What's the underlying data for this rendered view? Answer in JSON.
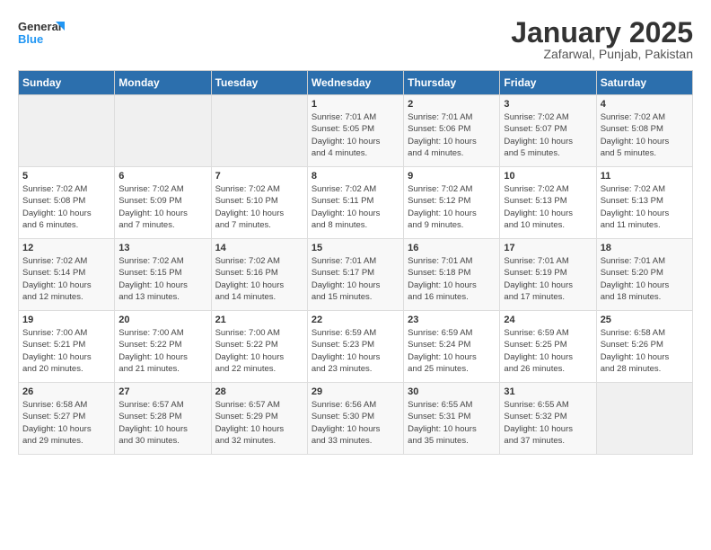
{
  "logo": {
    "line1": "General",
    "line2": "Blue"
  },
  "title": "January 2025",
  "subtitle": "Zafarwal, Punjab, Pakistan",
  "weekdays": [
    "Sunday",
    "Monday",
    "Tuesday",
    "Wednesday",
    "Thursday",
    "Friday",
    "Saturday"
  ],
  "weeks": [
    [
      {
        "day": "",
        "info": ""
      },
      {
        "day": "",
        "info": ""
      },
      {
        "day": "",
        "info": ""
      },
      {
        "day": "1",
        "info": "Sunrise: 7:01 AM\nSunset: 5:05 PM\nDaylight: 10 hours\nand 4 minutes."
      },
      {
        "day": "2",
        "info": "Sunrise: 7:01 AM\nSunset: 5:06 PM\nDaylight: 10 hours\nand 4 minutes."
      },
      {
        "day": "3",
        "info": "Sunrise: 7:02 AM\nSunset: 5:07 PM\nDaylight: 10 hours\nand 5 minutes."
      },
      {
        "day": "4",
        "info": "Sunrise: 7:02 AM\nSunset: 5:08 PM\nDaylight: 10 hours\nand 5 minutes."
      }
    ],
    [
      {
        "day": "5",
        "info": "Sunrise: 7:02 AM\nSunset: 5:08 PM\nDaylight: 10 hours\nand 6 minutes."
      },
      {
        "day": "6",
        "info": "Sunrise: 7:02 AM\nSunset: 5:09 PM\nDaylight: 10 hours\nand 7 minutes."
      },
      {
        "day": "7",
        "info": "Sunrise: 7:02 AM\nSunset: 5:10 PM\nDaylight: 10 hours\nand 7 minutes."
      },
      {
        "day": "8",
        "info": "Sunrise: 7:02 AM\nSunset: 5:11 PM\nDaylight: 10 hours\nand 8 minutes."
      },
      {
        "day": "9",
        "info": "Sunrise: 7:02 AM\nSunset: 5:12 PM\nDaylight: 10 hours\nand 9 minutes."
      },
      {
        "day": "10",
        "info": "Sunrise: 7:02 AM\nSunset: 5:13 PM\nDaylight: 10 hours\nand 10 minutes."
      },
      {
        "day": "11",
        "info": "Sunrise: 7:02 AM\nSunset: 5:13 PM\nDaylight: 10 hours\nand 11 minutes."
      }
    ],
    [
      {
        "day": "12",
        "info": "Sunrise: 7:02 AM\nSunset: 5:14 PM\nDaylight: 10 hours\nand 12 minutes."
      },
      {
        "day": "13",
        "info": "Sunrise: 7:02 AM\nSunset: 5:15 PM\nDaylight: 10 hours\nand 13 minutes."
      },
      {
        "day": "14",
        "info": "Sunrise: 7:02 AM\nSunset: 5:16 PM\nDaylight: 10 hours\nand 14 minutes."
      },
      {
        "day": "15",
        "info": "Sunrise: 7:01 AM\nSunset: 5:17 PM\nDaylight: 10 hours\nand 15 minutes."
      },
      {
        "day": "16",
        "info": "Sunrise: 7:01 AM\nSunset: 5:18 PM\nDaylight: 10 hours\nand 16 minutes."
      },
      {
        "day": "17",
        "info": "Sunrise: 7:01 AM\nSunset: 5:19 PM\nDaylight: 10 hours\nand 17 minutes."
      },
      {
        "day": "18",
        "info": "Sunrise: 7:01 AM\nSunset: 5:20 PM\nDaylight: 10 hours\nand 18 minutes."
      }
    ],
    [
      {
        "day": "19",
        "info": "Sunrise: 7:00 AM\nSunset: 5:21 PM\nDaylight: 10 hours\nand 20 minutes."
      },
      {
        "day": "20",
        "info": "Sunrise: 7:00 AM\nSunset: 5:22 PM\nDaylight: 10 hours\nand 21 minutes."
      },
      {
        "day": "21",
        "info": "Sunrise: 7:00 AM\nSunset: 5:22 PM\nDaylight: 10 hours\nand 22 minutes."
      },
      {
        "day": "22",
        "info": "Sunrise: 6:59 AM\nSunset: 5:23 PM\nDaylight: 10 hours\nand 23 minutes."
      },
      {
        "day": "23",
        "info": "Sunrise: 6:59 AM\nSunset: 5:24 PM\nDaylight: 10 hours\nand 25 minutes."
      },
      {
        "day": "24",
        "info": "Sunrise: 6:59 AM\nSunset: 5:25 PM\nDaylight: 10 hours\nand 26 minutes."
      },
      {
        "day": "25",
        "info": "Sunrise: 6:58 AM\nSunset: 5:26 PM\nDaylight: 10 hours\nand 28 minutes."
      }
    ],
    [
      {
        "day": "26",
        "info": "Sunrise: 6:58 AM\nSunset: 5:27 PM\nDaylight: 10 hours\nand 29 minutes."
      },
      {
        "day": "27",
        "info": "Sunrise: 6:57 AM\nSunset: 5:28 PM\nDaylight: 10 hours\nand 30 minutes."
      },
      {
        "day": "28",
        "info": "Sunrise: 6:57 AM\nSunset: 5:29 PM\nDaylight: 10 hours\nand 32 minutes."
      },
      {
        "day": "29",
        "info": "Sunrise: 6:56 AM\nSunset: 5:30 PM\nDaylight: 10 hours\nand 33 minutes."
      },
      {
        "day": "30",
        "info": "Sunrise: 6:55 AM\nSunset: 5:31 PM\nDaylight: 10 hours\nand 35 minutes."
      },
      {
        "day": "31",
        "info": "Sunrise: 6:55 AM\nSunset: 5:32 PM\nDaylight: 10 hours\nand 37 minutes."
      },
      {
        "day": "",
        "info": ""
      }
    ]
  ]
}
